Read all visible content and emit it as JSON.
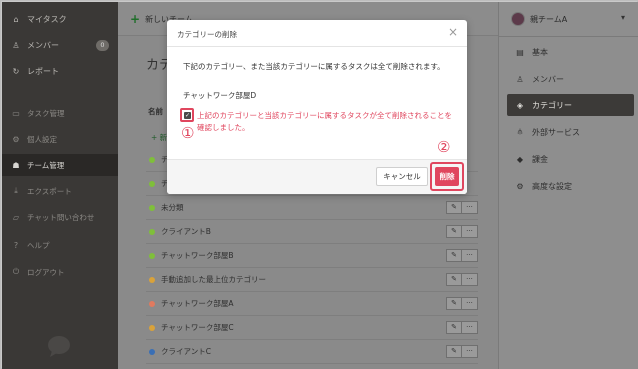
{
  "sidebar": {
    "items": [
      {
        "label": "マイタスク",
        "icon": "home-icon"
      },
      {
        "label": "メンバー",
        "icon": "person-icon",
        "badge": "0"
      },
      {
        "label": "レポート",
        "icon": "refresh-icon"
      },
      {
        "label": "タスク管理",
        "icon": "folder-icon"
      },
      {
        "label": "個人設定",
        "icon": "gear-icon"
      },
      {
        "label": "チーム管理",
        "icon": "people-icon"
      },
      {
        "label": "エクスポート",
        "icon": "download-icon"
      },
      {
        "label": "チャット問い合わせ",
        "icon": "chat-icon"
      },
      {
        "label": "ヘルプ",
        "icon": "help-icon"
      },
      {
        "label": "ログアウト",
        "icon": "power-icon"
      }
    ]
  },
  "main": {
    "new_team": "新しいチーム",
    "page_title": "カテ",
    "col_name": "名前",
    "new_category": "+ 新",
    "rows": [
      {
        "name": "チ",
        "color": "#7fbf3a"
      },
      {
        "name": "チ",
        "color": "#7fbf3a"
      },
      {
        "name": "未分類",
        "color": "#7fbf3a"
      },
      {
        "name": "クライアントB",
        "color": "#7fbf3a"
      },
      {
        "name": "チャットワーク部屋B",
        "color": "#7fbf3a"
      },
      {
        "name": "手動追加した最上位カテゴリー",
        "color": "#d9a23a"
      },
      {
        "name": "チャットワーク部屋A",
        "color": "#e07a5f"
      },
      {
        "name": "チャットワーク部屋C",
        "color": "#d9a23a"
      },
      {
        "name": "クライアントC",
        "color": "#3a6fb5"
      }
    ],
    "edit_symbol": "✎",
    "more_symbol": "···"
  },
  "right": {
    "team_name": "親チームA",
    "items": [
      {
        "label": "基本",
        "icon": "inbox-icon"
      },
      {
        "label": "メンバー",
        "icon": "person-icon"
      },
      {
        "label": "カテゴリー",
        "icon": "tag-icon"
      },
      {
        "label": "外部サービス",
        "icon": "network-icon"
      },
      {
        "label": "課金",
        "icon": "diamond-icon"
      },
      {
        "label": "高度な設定",
        "icon": "gear-icon"
      }
    ]
  },
  "modal": {
    "title": "カテゴリーの削除",
    "close": "×",
    "description": "下記のカテゴリー、また当該カテゴリーに属するタスクは全て削除されます。",
    "category": "チャットワーク部屋D",
    "confirm_text": "上記のカテゴリーと当該カテゴリーに属するタスクが全て削除されることを確認しました。",
    "annotation_1": "①",
    "annotation_2": "②",
    "cancel_label": "キャンセル",
    "delete_label": "削除"
  },
  "colors": {
    "accent": "#e0465e",
    "sidebar": "#3a3836"
  }
}
